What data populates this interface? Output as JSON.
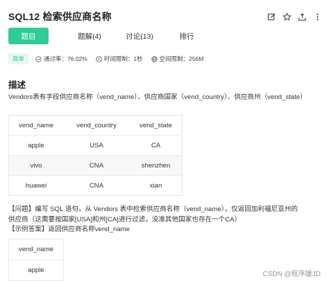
{
  "header": {
    "title": "SQL12  检索供应商名称",
    "icons": [
      "edit-icon",
      "star-icon",
      "share-icon",
      "more-icon"
    ]
  },
  "tabs": [
    {
      "label": "题目",
      "active": true
    },
    {
      "label": "题解(4)",
      "active": false
    },
    {
      "label": "讨论(13)",
      "active": false
    },
    {
      "label": "排行",
      "active": false
    }
  ],
  "meta": {
    "difficulty": "简单",
    "pass_rate": "通过率：76.02%",
    "time_limit": "时间限制：1秒",
    "space_limit": "空间限制：256M"
  },
  "section_title": "描述",
  "description": "Vendors表有字段供应商名称（vend_name）、供应商国家（vend_country）、供应商州（vend_state）",
  "vendors_table": {
    "columns": [
      "vend_name",
      "vend_country",
      "vend_state"
    ],
    "rows": [
      [
        "apple",
        "USA",
        "CA"
      ],
      [
        "vivo",
        "CNA",
        "shenzhen"
      ],
      [
        "huawei",
        "CNA",
        "xian"
      ]
    ]
  },
  "problem": {
    "line1": "【问题】编写 SQL 语句，从 Vendors 表中检索供应商名称（vend_name），仅返回加利福尼亚州的",
    "line2": "供应商（这需要按国家[USA]和州[CA]进行过滤，没准其他国家也存在一个CA）",
    "line3": "【示例答案】返回供应商名称vend_name"
  },
  "answer_table": {
    "columns": [
      "vend_name"
    ],
    "rows": [
      [
        "apple"
      ]
    ]
  },
  "watermark": "CSDN @程序媛JD",
  "colors": {
    "accent": "#32ca99",
    "badge_bg": "#e8f8f1"
  }
}
